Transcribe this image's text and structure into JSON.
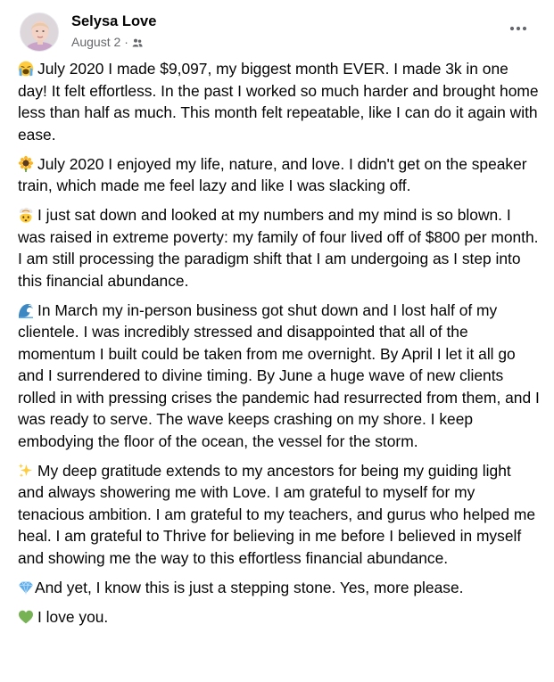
{
  "post": {
    "author": "Selysa Love",
    "date": "August 2",
    "separator": "·",
    "privacy_icon": "friends-icon",
    "options_icon": "more-horizontal-icon",
    "paragraphs": [
      {
        "emoji": "loudly-crying-face-icon",
        "text": "July 2020 I made $9,097, my biggest month EVER. I made 3k in one day! It felt effortless. In the past I worked so much harder and brought home less than half as much. This month felt repeatable, like I can do it again with ease."
      },
      {
        "emoji": "sunflower-icon",
        "text": "July 2020 I enjoyed my life, nature, and love. I didn't get on the speaker train, which made me feel lazy and like I was slacking off."
      },
      {
        "emoji": "exploding-head-icon",
        "text": "I just sat down and looked at my numbers and my mind is so blown. I was raised in extreme poverty: my family of four lived off of $800 per month. I am still processing the paradigm shift that I am undergoing as I step into this financial abundance."
      },
      {
        "emoji": "water-wave-icon",
        "text": "In March my in-person business got shut down and I lost half of my clientele. I was incredibly stressed and disappointed that all of the momentum I built could be taken from me overnight. By April I let it all go and I surrendered to divine timing. By June a huge wave of new clients rolled in with pressing crises the pandemic had resurrected from them, and I was ready to serve. The wave keeps crashing on my shore. I keep embodying the floor of the ocean, the vessel for the storm."
      },
      {
        "emoji": "sparkles-icon",
        "text": "My deep gratitude extends to my ancestors for being my guiding light and always showering me with Love. I am grateful to myself for my tenacious ambition. I am grateful to my teachers, and gurus who helped me heal. I am grateful to Thrive for believing in me before I believed in myself and showing me the way to this effortless financial abundance."
      },
      {
        "emoji": "gem-stone-icon",
        "text": "And yet, I know this is just a stepping stone. Yes, more please."
      },
      {
        "emoji": "green-heart-icon",
        "text": "I love you."
      }
    ]
  },
  "colors": {
    "text": "#050505",
    "secondary_text": "#65676b",
    "background": "#ffffff"
  }
}
